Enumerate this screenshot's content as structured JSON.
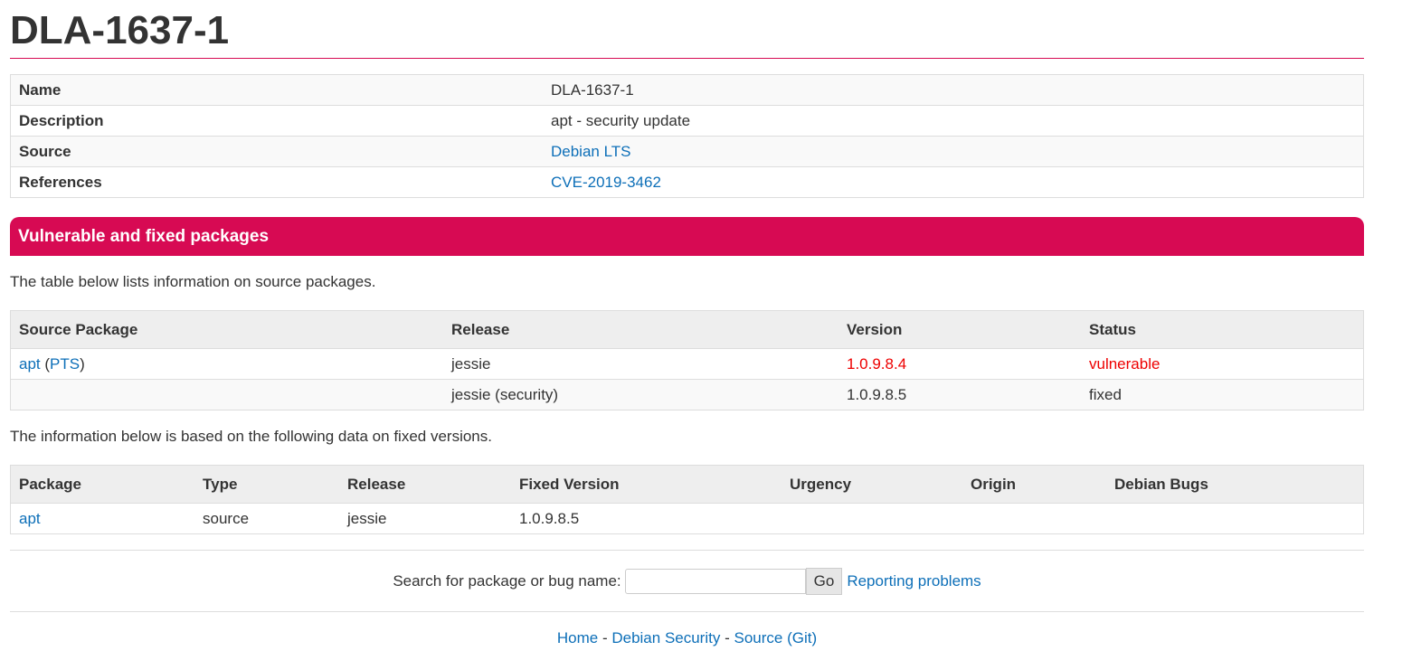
{
  "title": "DLA-1637-1",
  "info": {
    "name_label": "Name",
    "name_value": "DLA-1637-1",
    "description_label": "Description",
    "description_value": "apt - security update",
    "source_label": "Source",
    "source_value": "Debian LTS",
    "references_label": "References",
    "references_value": "CVE-2019-3462"
  },
  "section_title": "Vulnerable and fixed packages",
  "intro_text": "The table below lists information on source packages.",
  "packages": {
    "headers": [
      "Source Package",
      "Release",
      "Version",
      "Status"
    ],
    "rows": [
      {
        "package": "apt",
        "pts": "PTS",
        "release": "jessie",
        "version": "1.0.9.8.4",
        "status": "vulnerable"
      },
      {
        "package": "",
        "pts": "",
        "release": "jessie (security)",
        "version": "1.0.9.8.5",
        "status": "fixed"
      }
    ]
  },
  "fixed_intro": "The information below is based on the following data on fixed versions.",
  "fixed": {
    "headers": [
      "Package",
      "Type",
      "Release",
      "Fixed Version",
      "Urgency",
      "Origin",
      "Debian Bugs"
    ],
    "rows": [
      {
        "package": "apt",
        "type": "source",
        "release": "jessie",
        "fixed_version": "1.0.9.8.5",
        "urgency": "",
        "origin": "",
        "bugs": ""
      }
    ]
  },
  "search": {
    "label": "Search for package or bug name:",
    "value": "",
    "go_label": "Go",
    "report_link": "Reporting problems"
  },
  "footer": {
    "home": "Home",
    "sep": "-",
    "debian_security": "Debian Security",
    "source_git": "Source (Git)"
  },
  "colors": {
    "accent": "#d70a53",
    "link": "#0d6fb8",
    "vulnerable": "#ee0000"
  }
}
